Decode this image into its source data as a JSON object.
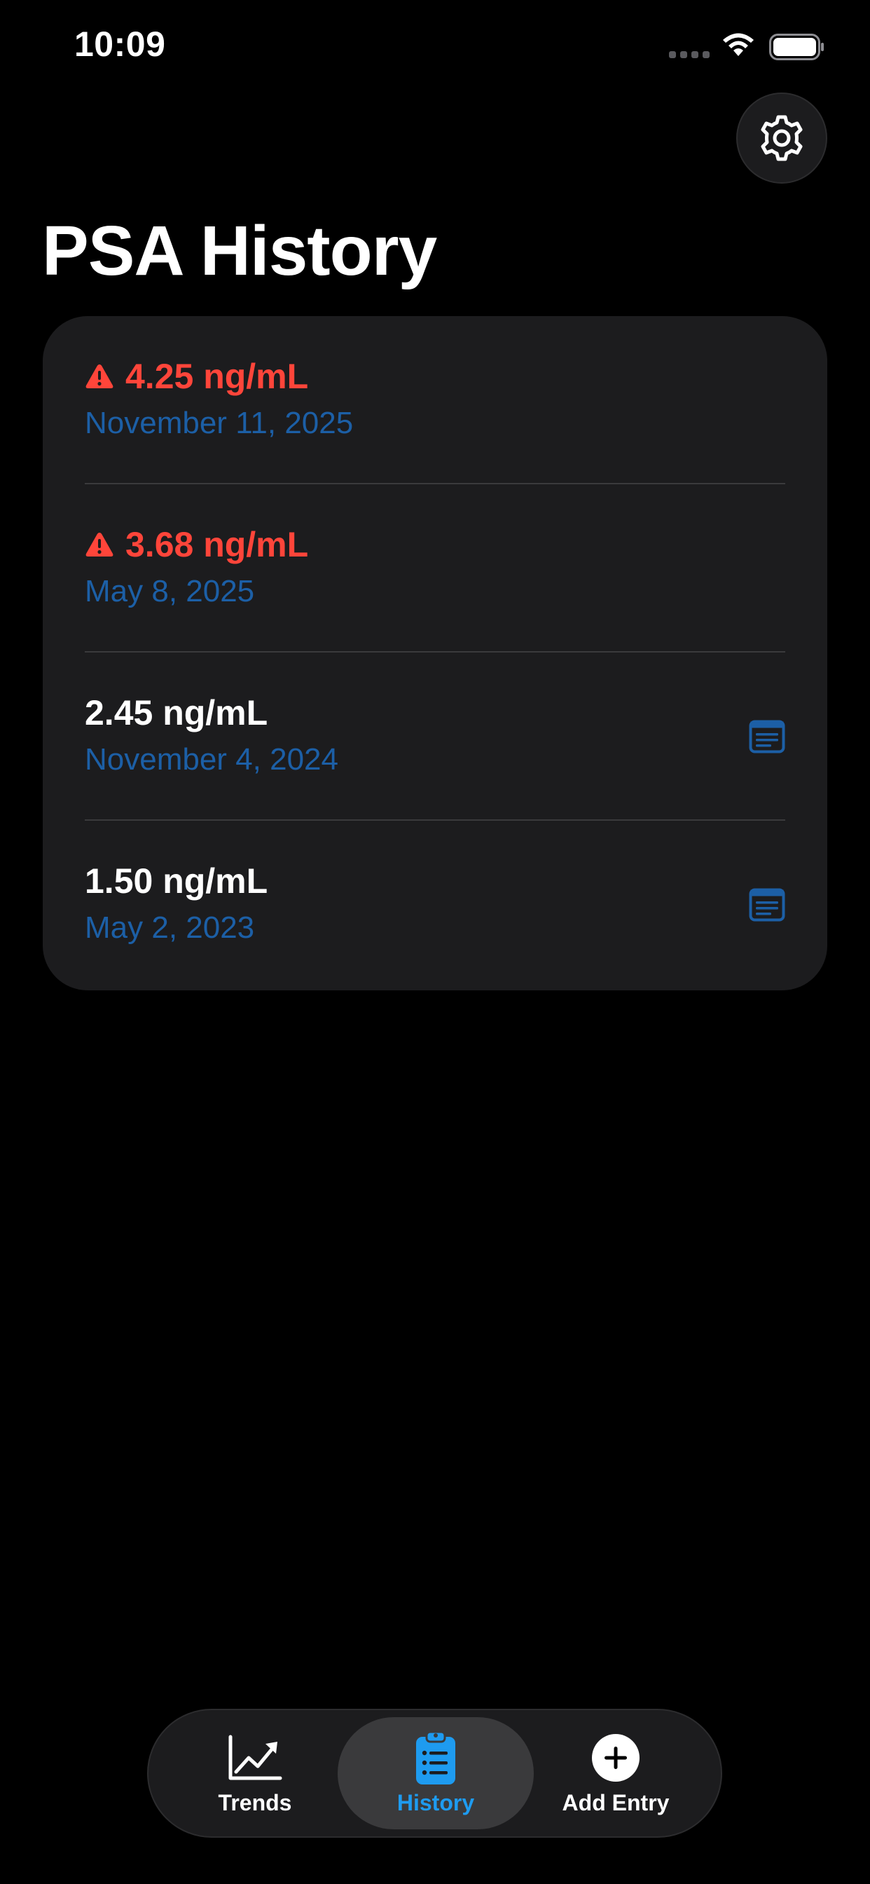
{
  "status_bar": {
    "time": "10:09"
  },
  "header": {
    "title": "PSA History",
    "settings_icon": "gear-icon"
  },
  "colors": {
    "background": "#000000",
    "card": "#1c1c1e",
    "elevated_value": "#ff453a",
    "date_text": "#1c5fa6",
    "accent": "#1e9bf0"
  },
  "history": {
    "entries": [
      {
        "value": "4.25 ng/mL",
        "date": "November 11, 2025",
        "elevated": true,
        "has_note": false
      },
      {
        "value": "3.68 ng/mL",
        "date": "May 8, 2025",
        "elevated": true,
        "has_note": false
      },
      {
        "value": "2.45 ng/mL",
        "date": "November 4, 2024",
        "elevated": false,
        "has_note": true
      },
      {
        "value": "1.50 ng/mL",
        "date": "May 2, 2023",
        "elevated": false,
        "has_note": true
      }
    ]
  },
  "tab_bar": {
    "selected": "History",
    "tabs": [
      {
        "label": "Trends",
        "icon": "chart-line-icon"
      },
      {
        "label": "History",
        "icon": "clipboard-list-icon"
      },
      {
        "label": "Add Entry",
        "icon": "plus-circle-icon"
      }
    ]
  }
}
